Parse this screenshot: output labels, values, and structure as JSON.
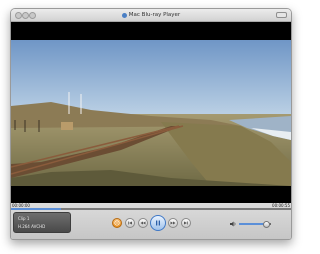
{
  "window": {
    "title": "Mac Blu-ray Player"
  },
  "playback": {
    "elapsed": "00:00:00",
    "duration": "00:00:55",
    "progress": 0.18,
    "volume": 0.85
  },
  "info": {
    "line1": "Clip 1",
    "line2": "H.264 AVCHD"
  },
  "icons": {
    "media_menu": "disc-icon",
    "previous": "previous-icon",
    "rewind": "rewind-icon",
    "play_pause": "pause-icon",
    "forward": "fast-forward-icon",
    "next": "next-icon",
    "volume": "speaker-icon"
  },
  "colors": {
    "accent": "#5b8fd8",
    "media_menu": "#e8901e"
  }
}
